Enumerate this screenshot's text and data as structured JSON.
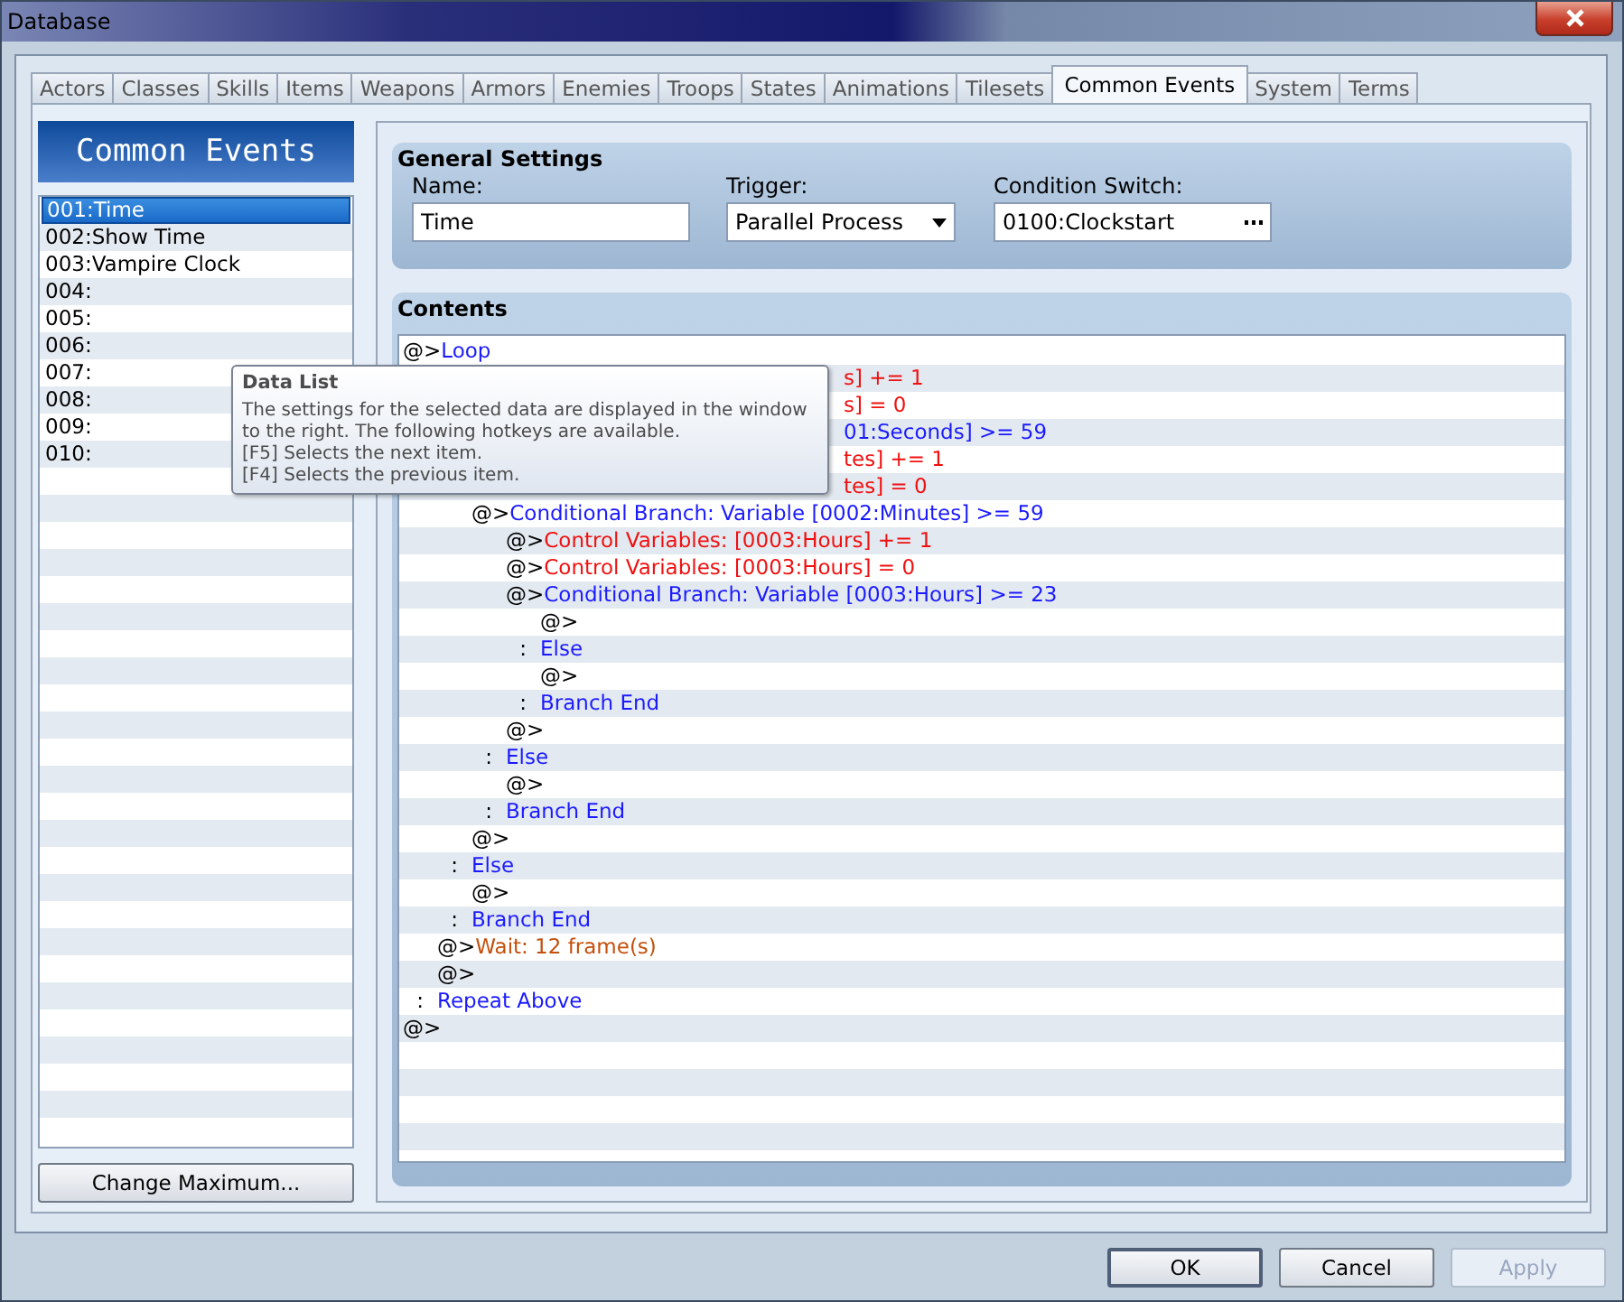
{
  "window": {
    "title": "Database"
  },
  "tabs": [
    {
      "label": "Actors",
      "selected": false
    },
    {
      "label": "Classes",
      "selected": false
    },
    {
      "label": "Skills",
      "selected": false
    },
    {
      "label": "Items",
      "selected": false
    },
    {
      "label": "Weapons",
      "selected": false
    },
    {
      "label": "Armors",
      "selected": false
    },
    {
      "label": "Enemies",
      "selected": false
    },
    {
      "label": "Troops",
      "selected": false
    },
    {
      "label": "States",
      "selected": false
    },
    {
      "label": "Animations",
      "selected": false
    },
    {
      "label": "Tilesets",
      "selected": false
    },
    {
      "label": "Common Events",
      "selected": true
    },
    {
      "label": "System",
      "selected": false
    },
    {
      "label": "Terms",
      "selected": false
    }
  ],
  "sidebar": {
    "title": "Common Events",
    "items": [
      {
        "label": "001:Time",
        "selected": true
      },
      {
        "label": "002:Show Time",
        "selected": false
      },
      {
        "label": "003:Vampire Clock",
        "selected": false
      },
      {
        "label": "004:",
        "selected": false
      },
      {
        "label": "005:",
        "selected": false
      },
      {
        "label": "006:",
        "selected": false
      },
      {
        "label": "007:",
        "selected": false
      },
      {
        "label": "008:",
        "selected": false
      },
      {
        "label": "009:",
        "selected": false
      },
      {
        "label": "010:",
        "selected": false
      }
    ],
    "button": "Change Maximum..."
  },
  "general_settings": {
    "title": "General Settings",
    "name_label": "Name:",
    "name_value": "Time",
    "trigger_label": "Trigger:",
    "trigger_value": "Parallel Process",
    "switch_label": "Condition Switch:",
    "switch_value": "0100:Clockstart"
  },
  "contents": {
    "title": "Contents",
    "lines": [
      {
        "kind": "command",
        "prefix": "@>",
        "text": "Loop",
        "color": "#1a1aff",
        "children": [
          {
            "kind": "partial",
            "text": "s] += 1",
            "color": "#f01010"
          },
          {
            "kind": "partial",
            "text": "s] = 0",
            "color": "#f01010"
          },
          {
            "kind": "partial",
            "text": "01:Seconds] >= 59",
            "color": "#1a1aff",
            "children": [
              {
                "kind": "partial",
                "text": "tes] += 1",
                "color": "#f01010"
              },
              {
                "kind": "partial",
                "text": "tes] = 0",
                "color": "#f01010"
              },
              {
                "kind": "command",
                "prefix": "@>",
                "text": "Conditional Branch: Variable [0002:Minutes] >= 59",
                "color": "#1a1aff",
                "children": [
                  {
                    "kind": "command",
                    "prefix": "@>",
                    "text": "Control Variables: [0003:Hours] += 1",
                    "color": "#f01010"
                  },
                  {
                    "kind": "command",
                    "prefix": "@>",
                    "text": "Control Variables: [0003:Hours] = 0",
                    "color": "#f01010"
                  },
                  {
                    "kind": "command",
                    "prefix": "@>",
                    "text": "Conditional Branch: Variable [0003:Hours] >= 23",
                    "color": "#1a1aff",
                    "children": [
                      {
                        "kind": "command",
                        "prefix": "@>"
                      }
                    ]
                  },
                  {
                    "kind": "command",
                    "prefix": ":",
                    "text": "Else",
                    "color": "#1a1aff",
                    "children": [
                      {
                        "kind": "command",
                        "prefix": "@>"
                      }
                    ]
                  },
                  {
                    "kind": "command",
                    "prefix": ":",
                    "text": "Branch End",
                    "color": "#1a1aff"
                  },
                  {
                    "kind": "command",
                    "prefix": "@>"
                  }
                ]
              },
              {
                "kind": "command",
                "prefix": ":",
                "text": "Else",
                "color": "#1a1aff",
                "children": [
                  {
                    "kind": "command",
                    "prefix": "@>"
                  }
                ]
              },
              {
                "kind": "command",
                "prefix": ":",
                "text": "Branch End",
                "color": "#1a1aff"
              },
              {
                "kind": "command",
                "prefix": "@>"
              }
            ]
          },
          {
            "kind": "command",
            "prefix": ":",
            "text": "Else",
            "color": "#1a1aff",
            "children": [
              {
                "kind": "command",
                "prefix": "@>"
              }
            ]
          },
          {
            "kind": "command",
            "prefix": ":",
            "text": "Branch End",
            "color": "#1a1aff"
          },
          {
            "kind": "command",
            "prefix": "@>",
            "text": "Wait: 12 frame(s)",
            "color": "#c4500c"
          },
          {
            "kind": "command",
            "prefix": "@>"
          }
        ]
      },
      {
        "kind": "command",
        "prefix": ":",
        "text": "Repeat Above",
        "color": "#1a1aff"
      },
      {
        "kind": "command",
        "prefix": "@>"
      }
    ]
  },
  "tooltip": {
    "title": "Data List",
    "lines": [
      "The settings for the selected data are displayed in the window",
      "to the right. The following hotkeys are available.",
      "[F5] Selects the next item.",
      "[F4] Selects the previous item."
    ]
  },
  "buttons": [
    {
      "label": "OK",
      "disabled": false
    },
    {
      "label": "Cancel",
      "disabled": false
    },
    {
      "label": "Apply",
      "disabled": true
    }
  ]
}
